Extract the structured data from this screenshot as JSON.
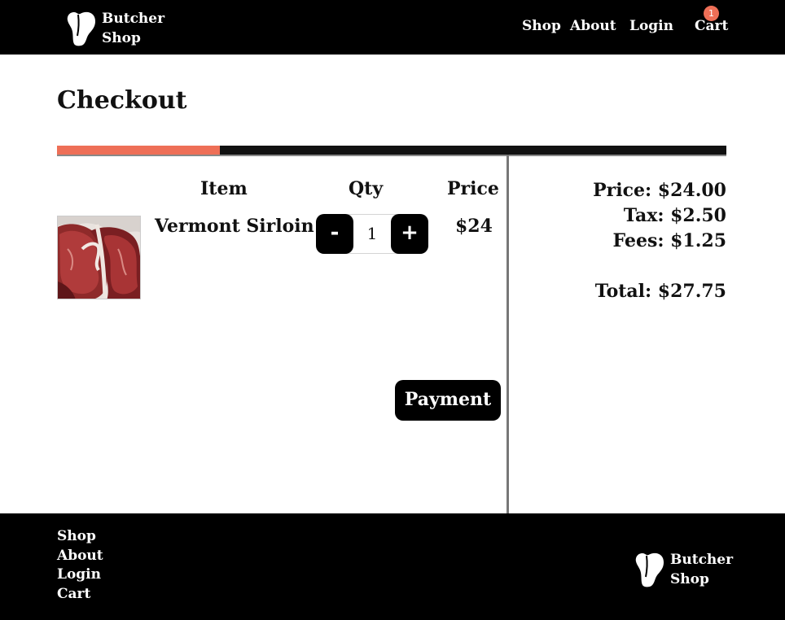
{
  "header": {
    "brand_line1": "Butcher",
    "brand_line2": "Shop",
    "nav": {
      "shop": "Shop",
      "about": "About",
      "login": "Login",
      "cart": "Cart"
    },
    "cart_count": "1"
  },
  "checkout": {
    "title": "Checkout",
    "progress": 0.243,
    "colors": {
      "accent": "#ee6f57",
      "dark": "#000000"
    }
  },
  "cart": {
    "headers": {
      "item": "Item",
      "qty": "Qty",
      "price": "Price"
    },
    "items": [
      {
        "name": "Vermont Sirloin",
        "qty": "1",
        "price": "$24",
        "minus_label": "-",
        "plus_label": "+",
        "image": "steak-photo"
      }
    ],
    "payment_label": "Payment"
  },
  "summary": {
    "price": "Price: $24.00",
    "tax": "Tax: $2.50",
    "fees": "Fees: $1.25",
    "total": "Total:  $27.75"
  },
  "footer": {
    "links": {
      "shop": "Shop",
      "about": "About",
      "login": "Login",
      "cart": "Cart"
    },
    "brand_line1": "Butcher",
    "brand_line2": "Shop"
  }
}
